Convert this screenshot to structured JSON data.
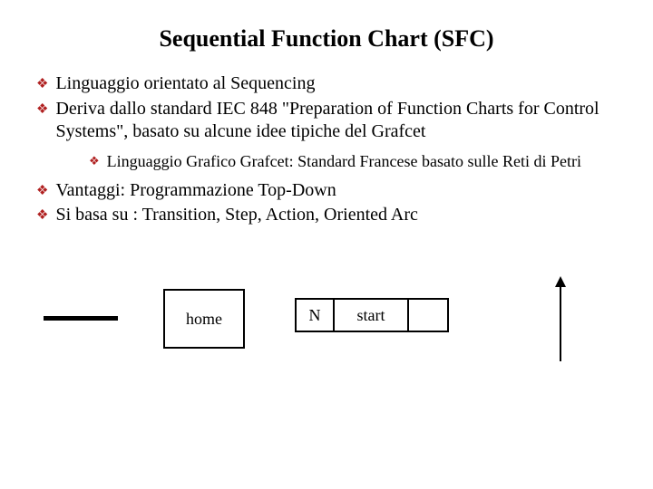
{
  "title": "Sequential Function Chart (SFC)",
  "bullets": {
    "b1": "Linguaggio orientato al Sequencing",
    "b2": "Deriva dallo standard IEC 848 \"Preparation of Function Charts for Control Systems\", basato su alcune idee tipiche del Grafcet",
    "b2_1": "Linguaggio Grafico Grafcet: Standard Francese basato sulle Reti di Petri",
    "b3": "Vantaggi: Programmazione Top-Down",
    "b4": "Si basa su : Transition, Step, Action, Oriented Arc"
  },
  "diagram": {
    "home": "home",
    "qualifier": "N",
    "action": "start"
  }
}
